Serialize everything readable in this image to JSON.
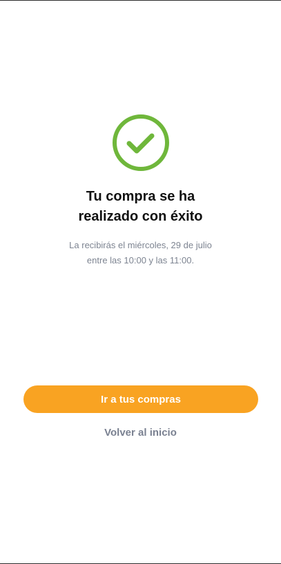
{
  "success": {
    "icon": "check-circle-icon",
    "icon_color": "#6fb73b",
    "title_line1": "Tu compra se ha",
    "title_line2": "realizado con éxito",
    "message_line1": "La recibirás el miércoles, 29 de julio",
    "message_line2": "entre las 10:00 y las 11:00."
  },
  "actions": {
    "primary_label": "Ir a tus compras",
    "primary_color": "#f9a322",
    "secondary_label": "Volver al inicio",
    "secondary_color": "#7a8191"
  }
}
